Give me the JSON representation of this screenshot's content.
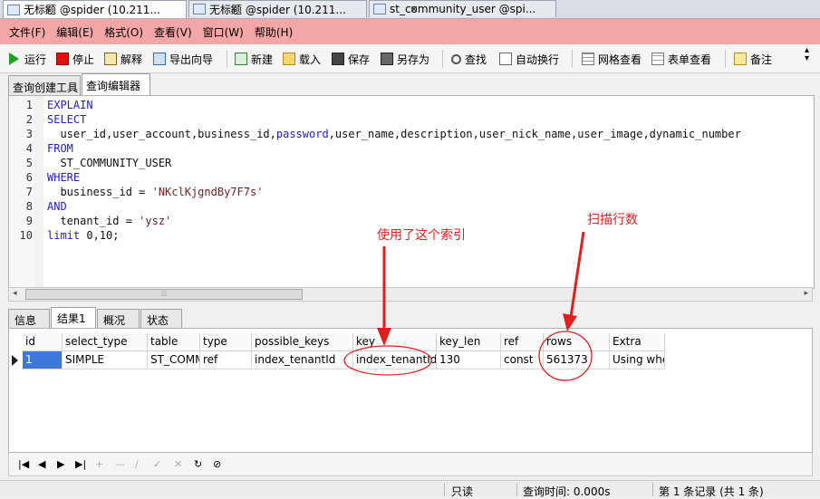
{
  "window_tabs": [
    {
      "label": "无标题 @spider (10.211...",
      "active": true
    },
    {
      "label": "无标题 @spider (10.211...",
      "active": false
    },
    {
      "label": "st_community_user @spi...",
      "active": false
    }
  ],
  "menu": [
    "文件(F)",
    "编辑(E)",
    "格式(O)",
    "查看(V)",
    "窗口(W)",
    "帮助(H)"
  ],
  "toolbar": {
    "run": "运行",
    "stop": "停止",
    "explain": "解释",
    "export_wizard": "导出向导",
    "new": "新建",
    "load": "载入",
    "save": "保存",
    "save_as": "另存为",
    "find": "查找",
    "word_wrap": "自动换行",
    "grid_view": "网格查看",
    "form_view": "表单查看",
    "memo": "备注"
  },
  "query_tabs": [
    "查询创建工具",
    "查询编辑器"
  ],
  "editor": {
    "lines": [
      {
        "n": "1",
        "kw": "EXPLAIN",
        "rest": ""
      },
      {
        "n": "2",
        "kw": "SELECT",
        "rest": ""
      },
      {
        "n": "3",
        "kw": "",
        "rest": "  user_id,user_account,business_id,",
        "kw2": "password",
        "rest2": ",user_name,description,user_nick_name,user_image,dynamic_number"
      },
      {
        "n": "4",
        "kw": "FROM",
        "rest": ""
      },
      {
        "n": "5",
        "kw": "",
        "rest": "  ST_COMMUNITY_USER"
      },
      {
        "n": "6",
        "kw": "WHERE",
        "rest": ""
      },
      {
        "n": "7",
        "kw": "",
        "rest": "  business_id = ",
        "str": "'NKclKjgndBy7F7s'"
      },
      {
        "n": "8",
        "kw": "AND",
        "rest": ""
      },
      {
        "n": "9",
        "kw": "",
        "rest": "  tenant_id = ",
        "str": "'ysz'"
      },
      {
        "n": "10",
        "kw": "limit",
        "rest": " 0,10;"
      }
    ]
  },
  "result_tabs": [
    "信息",
    "结果1",
    "概况",
    "状态"
  ],
  "grid": {
    "columns": [
      "id",
      "select_type",
      "table",
      "type",
      "possible_keys",
      "key",
      "key_len",
      "ref",
      "rows",
      "Extra"
    ],
    "row": [
      "1",
      "SIMPLE",
      "ST_COMM",
      "ref",
      "index_tenantId",
      "index_tenantId",
      "130",
      "const",
      "561373",
      "Using whe"
    ]
  },
  "annotations": {
    "key_note": "使用了这个索引",
    "rows_note": "扫描行数"
  },
  "status": {
    "readonly": "只读",
    "query_time": "查询时间: 0.000s",
    "record": "第 1 条记录 (共 1 条)"
  },
  "colors": {
    "menu_bg": "#f3a6a6",
    "keyword": "#2020c8",
    "selection": "#3b78d8",
    "annotation": "#e02020"
  }
}
